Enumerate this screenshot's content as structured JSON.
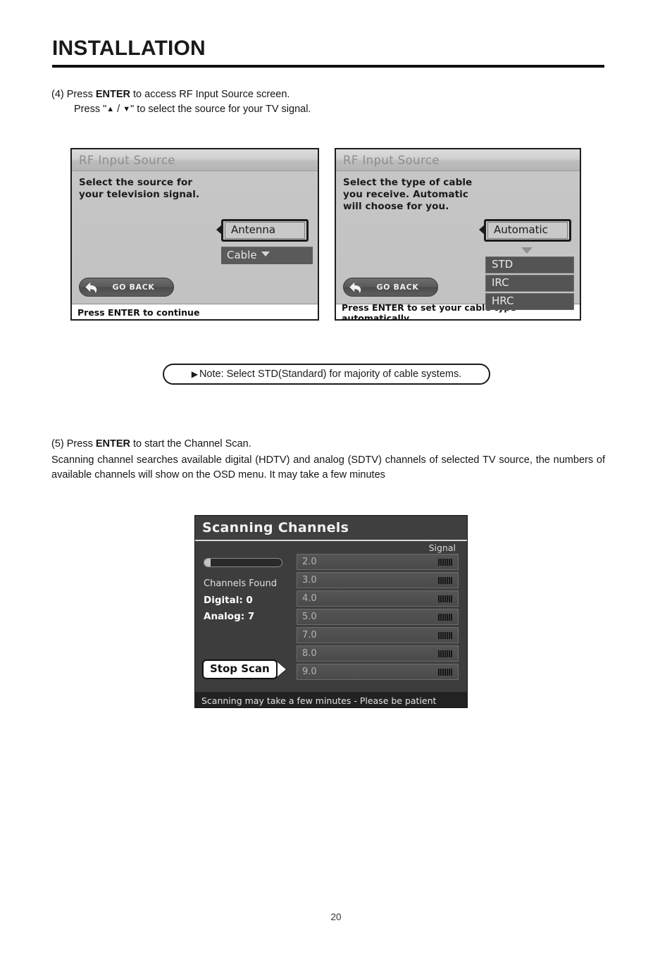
{
  "document": {
    "title": "INSTALLATION",
    "page_number": "20"
  },
  "steps": {
    "step4": {
      "line1_prefix": "(4) Press ",
      "line1_bold": "ENTER",
      "line1_suffix": " to access RF Input Source screen.",
      "line2_prefix": "Press \"",
      "line2_up": "▲",
      "line2_sep": " / ",
      "line2_down": "▼",
      "line2_suffix": "\" to select the source for your TV signal."
    },
    "step5": {
      "line1_prefix": "(5) Press ",
      "line1_bold": "ENTER",
      "line1_suffix": " to start the Channel Scan.",
      "paragraph": "Scanning channel searches available digital (HDTV) and analog (SDTV) channels of selected TV source, the numbers of available channels will show on the OSD menu. It may take a few minutes"
    }
  },
  "note": {
    "arrow": "▶",
    "text": "Note: Select STD(Standard) for majority of cable systems."
  },
  "osd_panel_1": {
    "title": "RF Input Source",
    "description_line1": "Select the source for",
    "description_line2": "your television signal.",
    "selected_option": "Antenna",
    "second_option": "Cable",
    "go_back_label": "GO BACK",
    "footer_text": "Press ENTER to continue"
  },
  "osd_panel_2": {
    "title": "RF Input Source",
    "description_line1": "Select the type of cable",
    "description_line2": "you receive.  Automatic",
    "description_line3": "will choose for you.",
    "selected_option": "Automatic",
    "cable_types": [
      "STD",
      "IRC",
      "HRC"
    ],
    "go_back_label": "GO BACK",
    "footer_text": "Press ENTER to set your cable type automatically"
  },
  "scan_panel": {
    "title": "Scanning Channels",
    "signal_header": "Signal",
    "progress_percent": 8,
    "channels_found_label": "Channels Found",
    "digital_label": "Digital: 0",
    "analog_label": "Analog: 7",
    "stop_scan_label": "Stop Scan",
    "footer_text": "Scanning may take a few minutes - Please be patient",
    "channels": [
      {
        "number": "2.0",
        "signal_bars": 7
      },
      {
        "number": "3.0",
        "signal_bars": 7
      },
      {
        "number": "4.0",
        "signal_bars": 7
      },
      {
        "number": "5.0",
        "signal_bars": 7
      },
      {
        "number": "7.0",
        "signal_bars": 7
      },
      {
        "number": "8.0",
        "signal_bars": 7
      },
      {
        "number": "9.0",
        "signal_bars": 7
      }
    ]
  },
  "colors": {
    "page_bg": "#ffffff",
    "ink": "#1a1a1a",
    "osd_bg": "#c6c6c6",
    "osd_title": "#8d8d8d",
    "scan_bg": "#3d3d3d",
    "scan_footer_bg": "#222222"
  }
}
